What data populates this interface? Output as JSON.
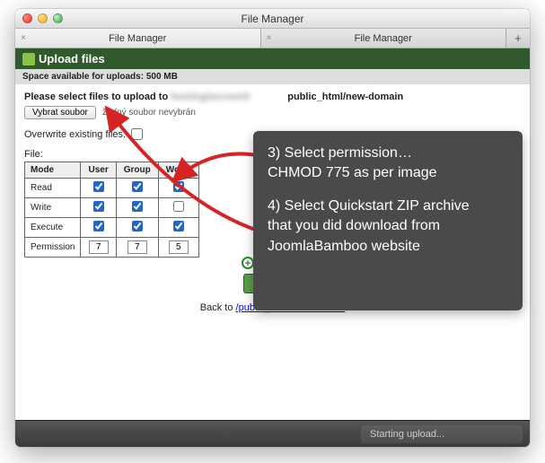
{
  "window": {
    "title": "File Manager"
  },
  "tabs": {
    "tab1": "File Manager",
    "tab2": "File Manager",
    "add": "+"
  },
  "header": {
    "title": "Upload files",
    "space": "Space available for uploads: 500 MB"
  },
  "body": {
    "select_label": "Please select files to upload to",
    "path_suffix": "public_html/new-domain",
    "choose_btn": "Vybrat soubor",
    "choose_status": "žádný soubor nevybrán",
    "overwrite_label": "Overwrite existing files:",
    "file_label": "File:"
  },
  "perm": {
    "h_mode": "Mode",
    "h_user": "User",
    "h_group": "Group",
    "h_world": "World",
    "r_read": "Read",
    "r_write": "Write",
    "r_exec": "Execute",
    "r_perm": "Permission",
    "v_user": "7",
    "v_group": "7",
    "v_world": "5",
    "cb": {
      "read_user": true,
      "read_group": true,
      "read_world": true,
      "write_user": true,
      "write_group": true,
      "write_world": false,
      "exec_user": true,
      "exec_group": true,
      "exec_world": true
    }
  },
  "upload_btn": "Upload",
  "backto": {
    "prefix": "Back to",
    "path": "/public_html/new-domain"
  },
  "statusbar": {
    "text": "Starting upload..."
  },
  "overlay": {
    "line1": "3) Select permission…",
    "line2": "CHMOD 775 as per image",
    "line3": "4) Select Quickstart ZIP archive",
    "line4": "that you did download from",
    "line5": "JoomlaBamboo website"
  }
}
